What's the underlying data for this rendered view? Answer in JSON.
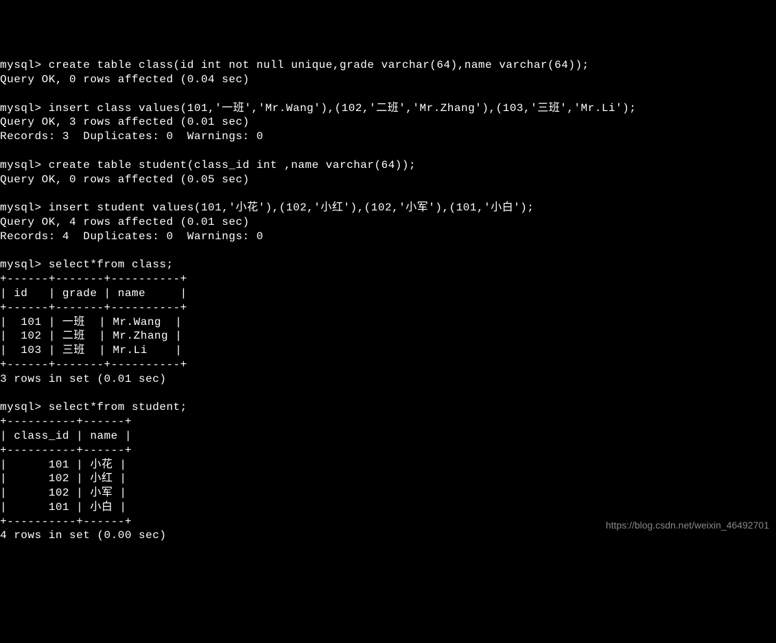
{
  "prompt": "mysql>",
  "commands": {
    "cmd1": "create table class(id int not null unique,grade varchar(64),name varchar(64));",
    "result1a": "Query OK, 0 rows affected (0.04 sec)",
    "cmd2": "insert class values(101,'一班','Mr.Wang'),(102,'二班','Mr.Zhang'),(103,'三班','Mr.Li');",
    "result2a": "Query OK, 3 rows affected (0.01 sec)",
    "result2b": "Records: 3  Duplicates: 0  Warnings: 0",
    "cmd3": "create table student(class_id int ,name varchar(64));",
    "result3a": "Query OK, 0 rows affected (0.05 sec)",
    "cmd4": "insert student values(101,'小花'),(102,'小红'),(102,'小军'),(101,'小白');",
    "result4a": "Query OK, 4 rows affected (0.01 sec)",
    "result4b": "Records: 4  Duplicates: 0  Warnings: 0",
    "cmd5": "select*from class;",
    "cmd6": "select*from student;"
  },
  "table1": {
    "border": "+------+-------+----------+",
    "header": "| id   | grade | name     |",
    "row1": "|  101 | 一班  | Mr.Wang  |",
    "row2": "|  102 | 二班  | Mr.Zhang |",
    "row3": "|  103 | 三班  | Mr.Li    |",
    "footer": "3 rows in set (0.01 sec)"
  },
  "table2": {
    "border": "+----------+------+",
    "header": "| class_id | name |",
    "row1": "|      101 | 小花 |",
    "row2": "|      102 | 小红 |",
    "row3": "|      102 | 小军 |",
    "row4": "|      101 | 小白 |",
    "footer": "4 rows in set (0.00 sec)"
  },
  "watermark": "https://blog.csdn.net/weixin_46492701"
}
